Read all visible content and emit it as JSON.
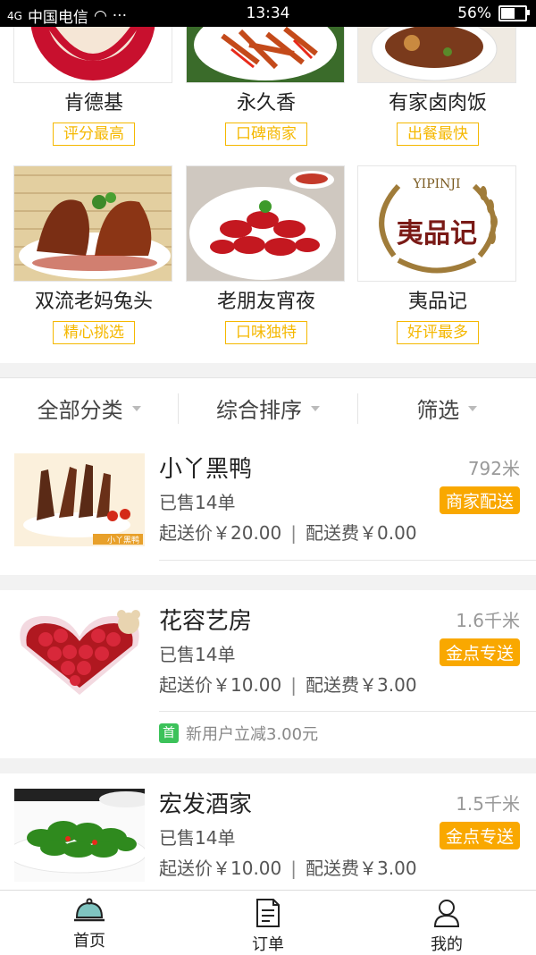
{
  "status": {
    "carrier": "中国电信",
    "signal": "4G",
    "time": "13:34",
    "battery": "56%",
    "battery_level": 0.56
  },
  "top_shops": [
    {
      "name": "肯德基",
      "tag": "评分最高"
    },
    {
      "name": "永久香",
      "tag": "口碑商家"
    },
    {
      "name": "有家卤肉饭",
      "tag": "出餐最快"
    },
    {
      "name": "双流老妈兔头",
      "tag": "精心挑选"
    },
    {
      "name": "老朋友宵夜",
      "tag": "口味独特"
    },
    {
      "name": "夷品记",
      "tag": "好评最多",
      "logo_text": "夷品记",
      "logo_latin": "YIPINJI"
    }
  ],
  "filters": {
    "category": "全部分类",
    "sort": "综合排序",
    "filter": "筛选"
  },
  "stores": [
    {
      "name": "小丫黑鸭",
      "distance": "792米",
      "sold": "已售14单",
      "badge": "商家配送",
      "min_price": "起送价￥20.00",
      "delivery_fee": "配送费￥0.00",
      "img_caption": "小丫黑鸭"
    },
    {
      "name": "花容艺房",
      "distance": "1.6千米",
      "sold": "已售14单",
      "badge": "金点专送",
      "min_price": "起送价￥10.00",
      "delivery_fee": "配送费￥3.00",
      "promo_icon": "首",
      "promo": "新用户立减3.00元"
    },
    {
      "name": "宏发酒家",
      "distance": "1.5千米",
      "sold": "已售14单",
      "badge": "金点专送",
      "min_price": "起送价￥10.00",
      "delivery_fee": "配送费￥3.00"
    }
  ],
  "tabs": [
    {
      "label": "首页",
      "icon": "cloche-icon"
    },
    {
      "label": "订单",
      "icon": "order-icon"
    },
    {
      "label": "我的",
      "icon": "user-icon"
    }
  ],
  "colors": {
    "accent": "#f9a800",
    "tag": "#f5b800",
    "promo": "#3cc25a"
  }
}
